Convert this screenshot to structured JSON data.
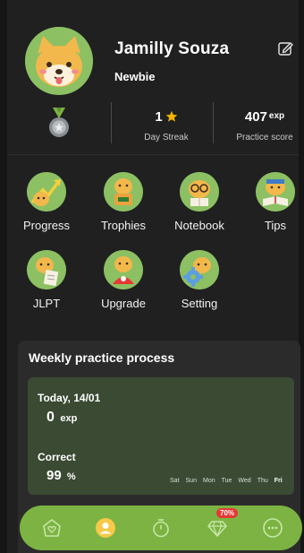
{
  "profile": {
    "name": "Jamilly Souza",
    "rank": "Newbie",
    "avatar_icon": "shiba-dog-avatar-icon"
  },
  "stats": {
    "streak_value": "1",
    "streak_label": "Day Streak",
    "score_value": "407",
    "score_unit": "exp",
    "score_label": "Practice score"
  },
  "menu": [
    {
      "label": "Progress",
      "icon": "progress-icon"
    },
    {
      "label": "Trophies",
      "icon": "trophies-icon"
    },
    {
      "label": "Notebook",
      "icon": "notebook-icon"
    },
    {
      "label": "Tips",
      "icon": "tips-icon"
    },
    {
      "label": "JLPT",
      "icon": "jlpt-icon"
    },
    {
      "label": "Upgrade",
      "icon": "upgrade-icon"
    },
    {
      "label": "Setting",
      "icon": "setting-icon"
    }
  ],
  "weekly": {
    "title": "Weekly practice process",
    "today_label": "Today, 14/01",
    "exp_value": "0",
    "exp_unit": "exp",
    "correct_label": "Correct",
    "correct_value": "99",
    "correct_unit": "%",
    "days": [
      "Sat",
      "Sun",
      "Mon",
      "Tue",
      "Wed",
      "Thu",
      "Fri"
    ],
    "active_day": "Fri"
  },
  "nav": {
    "badge": "70%",
    "items": [
      "home-icon",
      "profile-icon",
      "timer-icon",
      "diamond-icon",
      "more-icon"
    ]
  },
  "colors": {
    "background": "#202020",
    "accent_green": "#7cb342",
    "icon_green": "#8cc063",
    "card": "#2b2b2b",
    "practice_box": "#3a4a33",
    "badge_red": "#e53935",
    "star": "#f7b500"
  }
}
